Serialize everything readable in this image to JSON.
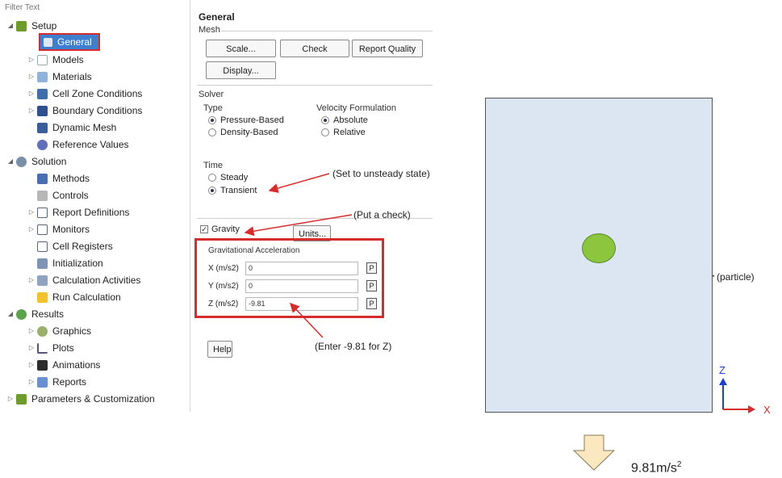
{
  "tree": {
    "filter_placeholder": "Filter Text",
    "items": [
      {
        "label": "Setup",
        "icon": "setup-icon",
        "toggle": "◢"
      },
      {
        "label": "General",
        "icon": "general-icon",
        "selected": true
      },
      {
        "label": "Models",
        "icon": "models-icon",
        "toggle": "▷"
      },
      {
        "label": "Materials",
        "icon": "materials-icon",
        "toggle": "▷"
      },
      {
        "label": "Cell Zone Conditions",
        "icon": "cell-zone-icon",
        "toggle": "▷"
      },
      {
        "label": "Boundary Conditions",
        "icon": "boundary-icon",
        "toggle": "▷"
      },
      {
        "label": "Dynamic Mesh",
        "icon": "dynamic-mesh-icon"
      },
      {
        "label": "Reference Values",
        "icon": "reference-values-icon"
      },
      {
        "label": "Solution",
        "icon": "solution-icon",
        "toggle": "◢"
      },
      {
        "label": "Methods",
        "icon": "methods-icon"
      },
      {
        "label": "Controls",
        "icon": "controls-icon"
      },
      {
        "label": "Report Definitions",
        "icon": "report-definitions-icon",
        "toggle": "▷"
      },
      {
        "label": "Monitors",
        "icon": "monitors-icon",
        "toggle": "▷"
      },
      {
        "label": "Cell Registers",
        "icon": "cell-registers-icon"
      },
      {
        "label": "Initialization",
        "icon": "initialization-icon"
      },
      {
        "label": "Calculation Activities",
        "icon": "calc-activities-icon",
        "toggle": "▷"
      },
      {
        "label": "Run Calculation",
        "icon": "run-calculation-icon"
      },
      {
        "label": "Results",
        "icon": "results-icon",
        "toggle": "◢"
      },
      {
        "label": "Graphics",
        "icon": "graphics-icon",
        "toggle": "▷"
      },
      {
        "label": "Plots",
        "icon": "plots-icon",
        "toggle": "▷"
      },
      {
        "label": "Animations",
        "icon": "animations-icon",
        "toggle": "▷"
      },
      {
        "label": "Reports",
        "icon": "reports-icon",
        "toggle": "▷"
      },
      {
        "label": "Parameters & Customization",
        "icon": "parameters-icon",
        "toggle": "▷"
      }
    ]
  },
  "general": {
    "title": "General",
    "mesh_label": "Mesh",
    "scale_btn": "Scale...",
    "check_btn": "Check",
    "report_quality_btn": "Report Quality",
    "display_btn": "Display...",
    "solver_label": "Solver",
    "type_label": "Type",
    "pressure_based": "Pressure-Based",
    "density_based": "Density-Based",
    "velocity_formulation_label": "Velocity Formulation",
    "absolute": "Absolute",
    "relative": "Relative",
    "time_label": "Time",
    "steady": "Steady",
    "transient": "Transient",
    "gravity_label": "Gravity",
    "units_btn": "Units...",
    "grav_accel_label": "Gravitational Acceleration",
    "x_label": "X (m/s2)",
    "x_value": "0",
    "y_label": "Y (m/s2)",
    "y_value": "0",
    "z_label": "Z (m/s2)",
    "z_value": "-9.81",
    "param_btn": "P",
    "help_btn": "Help"
  },
  "annotations": {
    "unsteady": "(Set to unsteady state)",
    "check": "(Put a check)",
    "enter_z": "(Enter -9.81 for Z)",
    "particle": "(particle)"
  },
  "diagram": {
    "axis_z": "Z",
    "axis_x": "X",
    "gravity_base": "9.81m/s",
    "gravity_sup": "2",
    "colors": {
      "domain_fill": "#dce6f2",
      "particle_fill": "#8cc63f",
      "axis": "#1f3fd1",
      "arrow_red": "#d62c2c",
      "gravity_arrow": "#fbe8c0"
    }
  }
}
